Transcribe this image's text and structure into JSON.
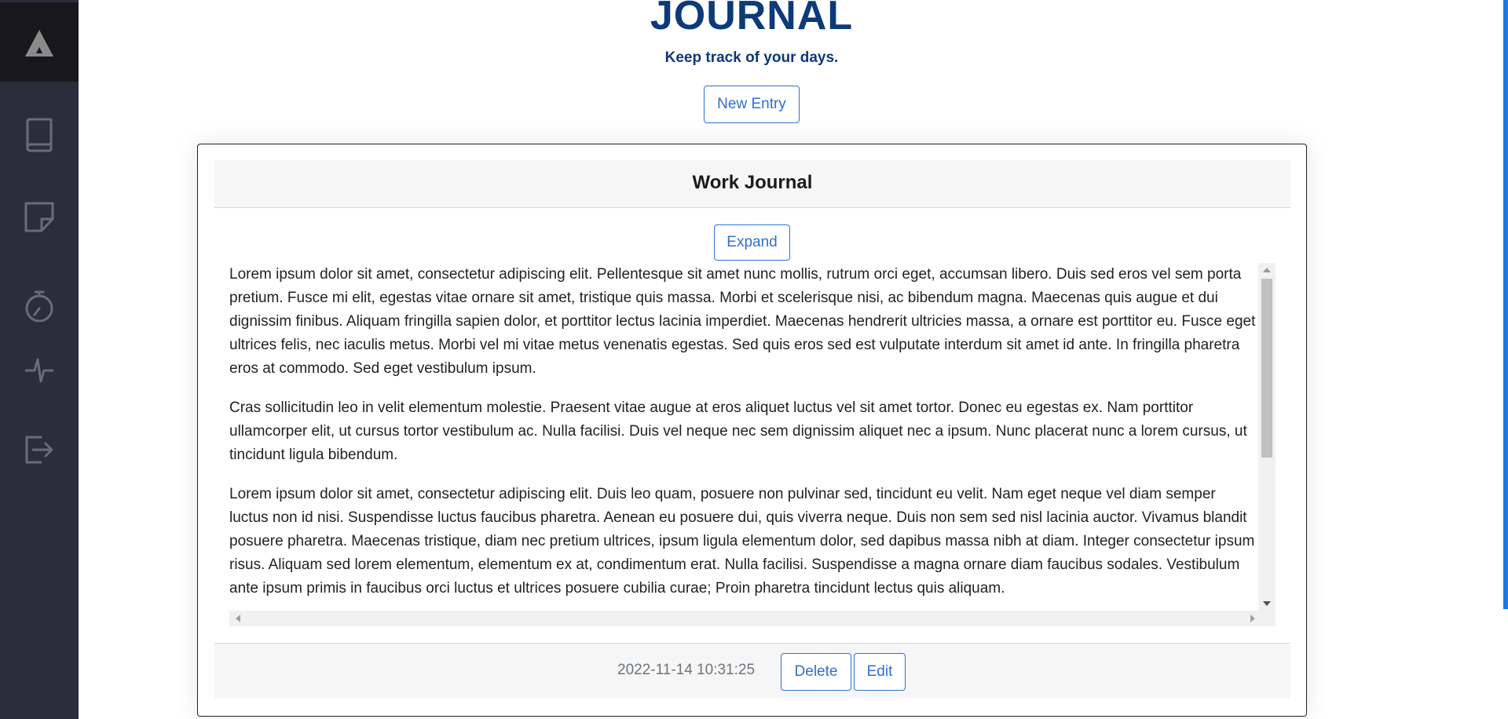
{
  "app": {
    "title": "JOURNAL",
    "subtitle": "Keep track of your days.",
    "new_entry_label": "New Entry"
  },
  "sidebar": {
    "items": [
      {
        "icon": "logo-triangle-icon"
      },
      {
        "icon": "book-icon"
      },
      {
        "icon": "sticky-note-icon"
      },
      {
        "icon": "stopwatch-icon"
      },
      {
        "icon": "activity-pulse-icon"
      },
      {
        "icon": "logout-icon"
      }
    ]
  },
  "entry": {
    "title": "Work Journal",
    "expand_label": "Expand",
    "paragraphs": [
      "Lorem ipsum dolor sit amet, consectetur adipiscing elit. Pellentesque sit amet nunc mollis, rutrum orci eget, accumsan libero. Duis sed eros vel sem porta pretium. Fusce mi elit, egestas vitae ornare sit amet, tristique quis massa. Morbi et scelerisque nisi, ac bibendum magna. Maecenas quis augue et dui dignissim finibus. Aliquam fringilla sapien dolor, et porttitor lectus lacinia imperdiet. Maecenas hendrerit ultricies massa, a ornare est porttitor eu. Fusce eget ultrices felis, nec iaculis metus. Morbi vel mi vitae metus venenatis egestas. Sed quis eros sed est vulputate interdum sit amet id ante. In fringilla pharetra eros at commodo. Sed eget vestibulum ipsum.",
      "Cras sollicitudin leo in velit elementum molestie. Praesent vitae augue at eros aliquet luctus vel sit amet tortor. Donec eu egestas ex. Nam porttitor ullamcorper elit, ut cursus tortor vestibulum ac. Nulla facilisi. Duis vel neque nec sem dignissim aliquet nec a ipsum. Nunc placerat nunc a lorem cursus, ut tincidunt ligula bibendum.",
      "Lorem ipsum dolor sit amet, consectetur adipiscing elit. Duis leo quam, posuere non pulvinar sed, tincidunt eu velit. Nam eget neque vel diam semper luctus non id nisi. Suspendisse luctus faucibus pharetra. Aenean eu posuere dui, quis viverra neque. Duis non sem sed nisl lacinia auctor. Vivamus blandit posuere pharetra. Maecenas tristique, diam nec pretium ultrices, ipsum ligula elementum dolor, sed dapibus massa nibh at diam. Integer consectetur ipsum risus. Aliquam sed lorem elementum, elementum ex at, condimentum erat. Nulla facilisi. Suspendisse a magna ornare diam faucibus sodales. Vestibulum ante ipsum primis in faucibus orci luctus et ultrices posuere cubilia curae; Proin pharetra tincidunt lectus quis aliquam."
    ],
    "timestamp": "2022-11-14 10:31:25",
    "delete_label": "Delete",
    "edit_label": "Edit"
  },
  "colors": {
    "sidebar_bg": "#2c2c3c",
    "brand_bg": "#18181c",
    "title": "#0d3a78",
    "accent": "#2f6fd3",
    "right_bar": "#1e78e6"
  }
}
